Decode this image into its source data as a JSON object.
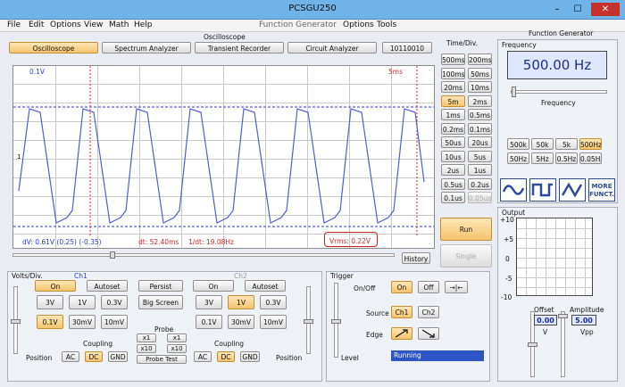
{
  "window": {
    "title": "PCSGU250",
    "minimize": "–",
    "maximize": "☐",
    "close": "✕"
  },
  "menu": {
    "file": "File",
    "edit": "Edit",
    "options": "Options",
    "view": "View",
    "math": "Math",
    "help": "Help",
    "fg_label": "Function Generator",
    "fg_options": "Options",
    "fg_tools": "Tools"
  },
  "sections": {
    "oscilloscope": "Oscilloscope",
    "function_generator": "Function Generator"
  },
  "tabs": {
    "oscilloscope": "Oscilloscope",
    "spectrum": "Spectrum Analyzer",
    "transient": "Transient Recorder",
    "circuit": "Circuit Analyzer",
    "bits": "10110010"
  },
  "screen": {
    "volt_label": "0.1V",
    "time_label": "5ms",
    "dv": "dV: 0.61V  (0.25) (-0.35)",
    "dt": "dt: 52.40ms",
    "inv_dt": "1/dt: 19.08Hz",
    "vrms": "Vrms: 0.22V",
    "history": "History",
    "marker": "1"
  },
  "timediv": {
    "title": "Time/Div.",
    "left": [
      "500ms",
      "100ms",
      "20ms",
      "5m",
      "1ms",
      "0.2ms",
      "50us",
      "10us",
      "2us",
      "0.5us",
      "0.1us"
    ],
    "right": [
      "200ms",
      "50ms",
      "10ms",
      "2ms",
      "0.5ms",
      "0.1ms",
      "20us",
      "5us",
      "1us",
      "0.2us",
      "0.05us"
    ],
    "run": "Run",
    "single": "Single"
  },
  "fg": {
    "freq_title": "Frequency",
    "freq_value": "500.00 Hz",
    "freq_label": "Frequency",
    "range_row1": [
      "500k",
      "50k",
      "5k",
      "500Hz"
    ],
    "range_row2": [
      "50Hz",
      "5Hz",
      "0.5Hz",
      "0.05Hz"
    ],
    "more1": "MORE",
    "more2": "FUNCT.",
    "output_title": "Output",
    "offset_label": "Offset",
    "offset_value": "0.00",
    "offset_unit": "V",
    "amp_label": "Amplitude",
    "amp_value": "5.00",
    "amp_unit": "Vpp",
    "y_ticks": [
      "+10",
      "+5",
      "0",
      "-5",
      "-10"
    ]
  },
  "volts": {
    "title": "Volts/Div.",
    "ch1": "Ch1",
    "ch2": "Ch2",
    "on": "On",
    "autoset": "Autoset",
    "persist": "Persist",
    "big_screen": "Big Screen",
    "v3": "3V",
    "v1": "1V",
    "v03": "0.3V",
    "v01": "0.1V",
    "mv30": "30mV",
    "mv10": "10mV",
    "probe": "Probe",
    "x1": "x1",
    "x10": "x10",
    "probe_test": "Probe Test",
    "coupling": "Coupling",
    "position": "Position",
    "ac": "AC",
    "dc": "DC",
    "gnd": "GND"
  },
  "trigger": {
    "title": "Trigger",
    "onoff": "On/Off",
    "on": "On",
    "off": "Off",
    "arrows": "→|←",
    "source": "Source",
    "ch1": "Ch1",
    "ch2": "Ch2",
    "edge": "Edge",
    "level": "Level",
    "status": "Running"
  }
}
